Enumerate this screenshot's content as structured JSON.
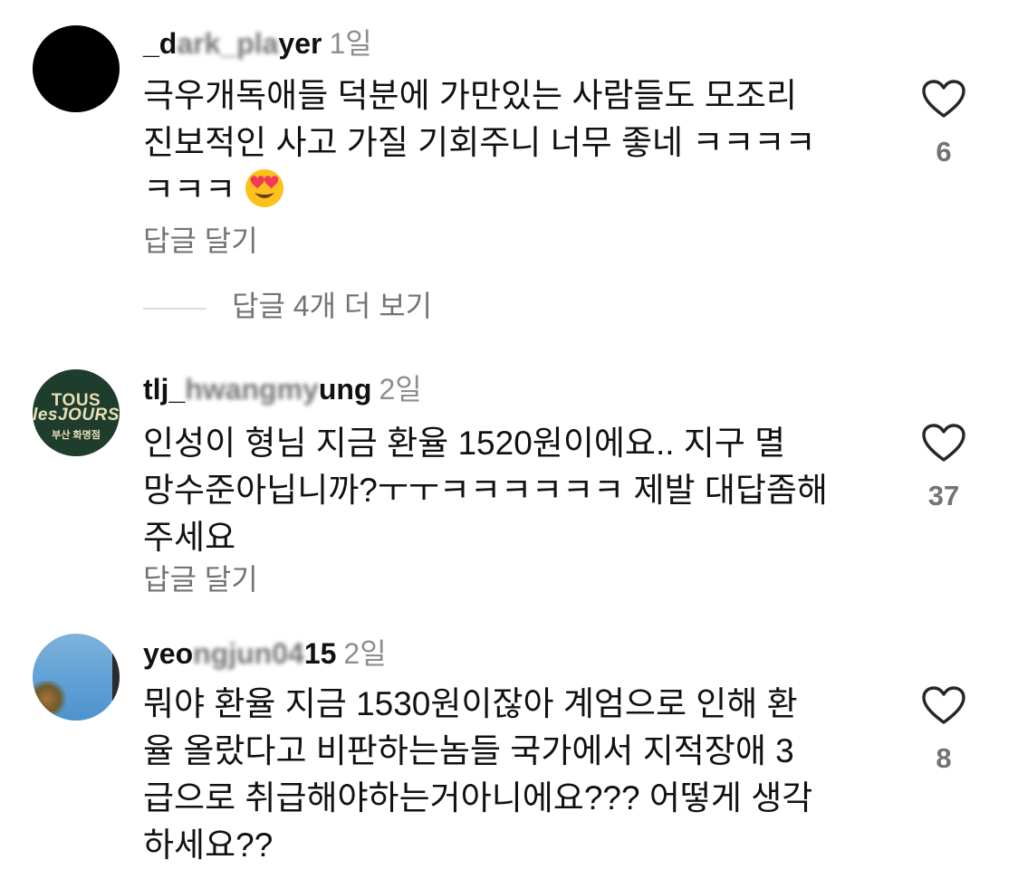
{
  "comments": [
    {
      "username_visible": "_d",
      "username_blurred": "ark_pla",
      "username_tail": "yer",
      "time": "1일",
      "lines": [
        "극우개독애들 덕분에 가만있는 사람들도 모조리",
        "진보적인 사고 가질 기회주니 너무 좋네 ㅋㅋㅋㅋ",
        "ㅋㅋㅋ"
      ],
      "emoji": "smiling-face-with-heart-eyes",
      "reply_label": "답글 달기",
      "view_replies_label": "답글 4개 더 보기",
      "likes": "6"
    },
    {
      "username_visible": "tlj_",
      "username_blurred": "hwangmy",
      "username_tail": "ung",
      "time": "2일",
      "avatar_text": {
        "line1": "TOUS",
        "line2": "lesJOURS",
        "line3": "부산 화명점"
      },
      "lines": [
        "인성이 형님 지금 환율 1520원이에요.. 지구 멸",
        "망수준아닙니까?ㅜㅜㅋㅋㅋㅋㅋㅋ 제발 대답좀해",
        "주세요"
      ],
      "reply_label": "답글 달기",
      "likes": "37"
    },
    {
      "username_visible": "yeo",
      "username_blurred": "ngjun04",
      "username_tail": "15",
      "time": "2일",
      "lines": [
        "뭐야 환율 지금 1530원이잖아 계엄으로 인해 환",
        "율 올랐다고  비판하는놈들 국가에서 지적장애 3",
        "급으로 취급해야하는거아니에요??? 어떻게 생각",
        "하세요??"
      ],
      "likes": "8"
    }
  ],
  "colors": {
    "text": "#111111",
    "secondary": "#737373",
    "divider": "#dbdbdb"
  }
}
